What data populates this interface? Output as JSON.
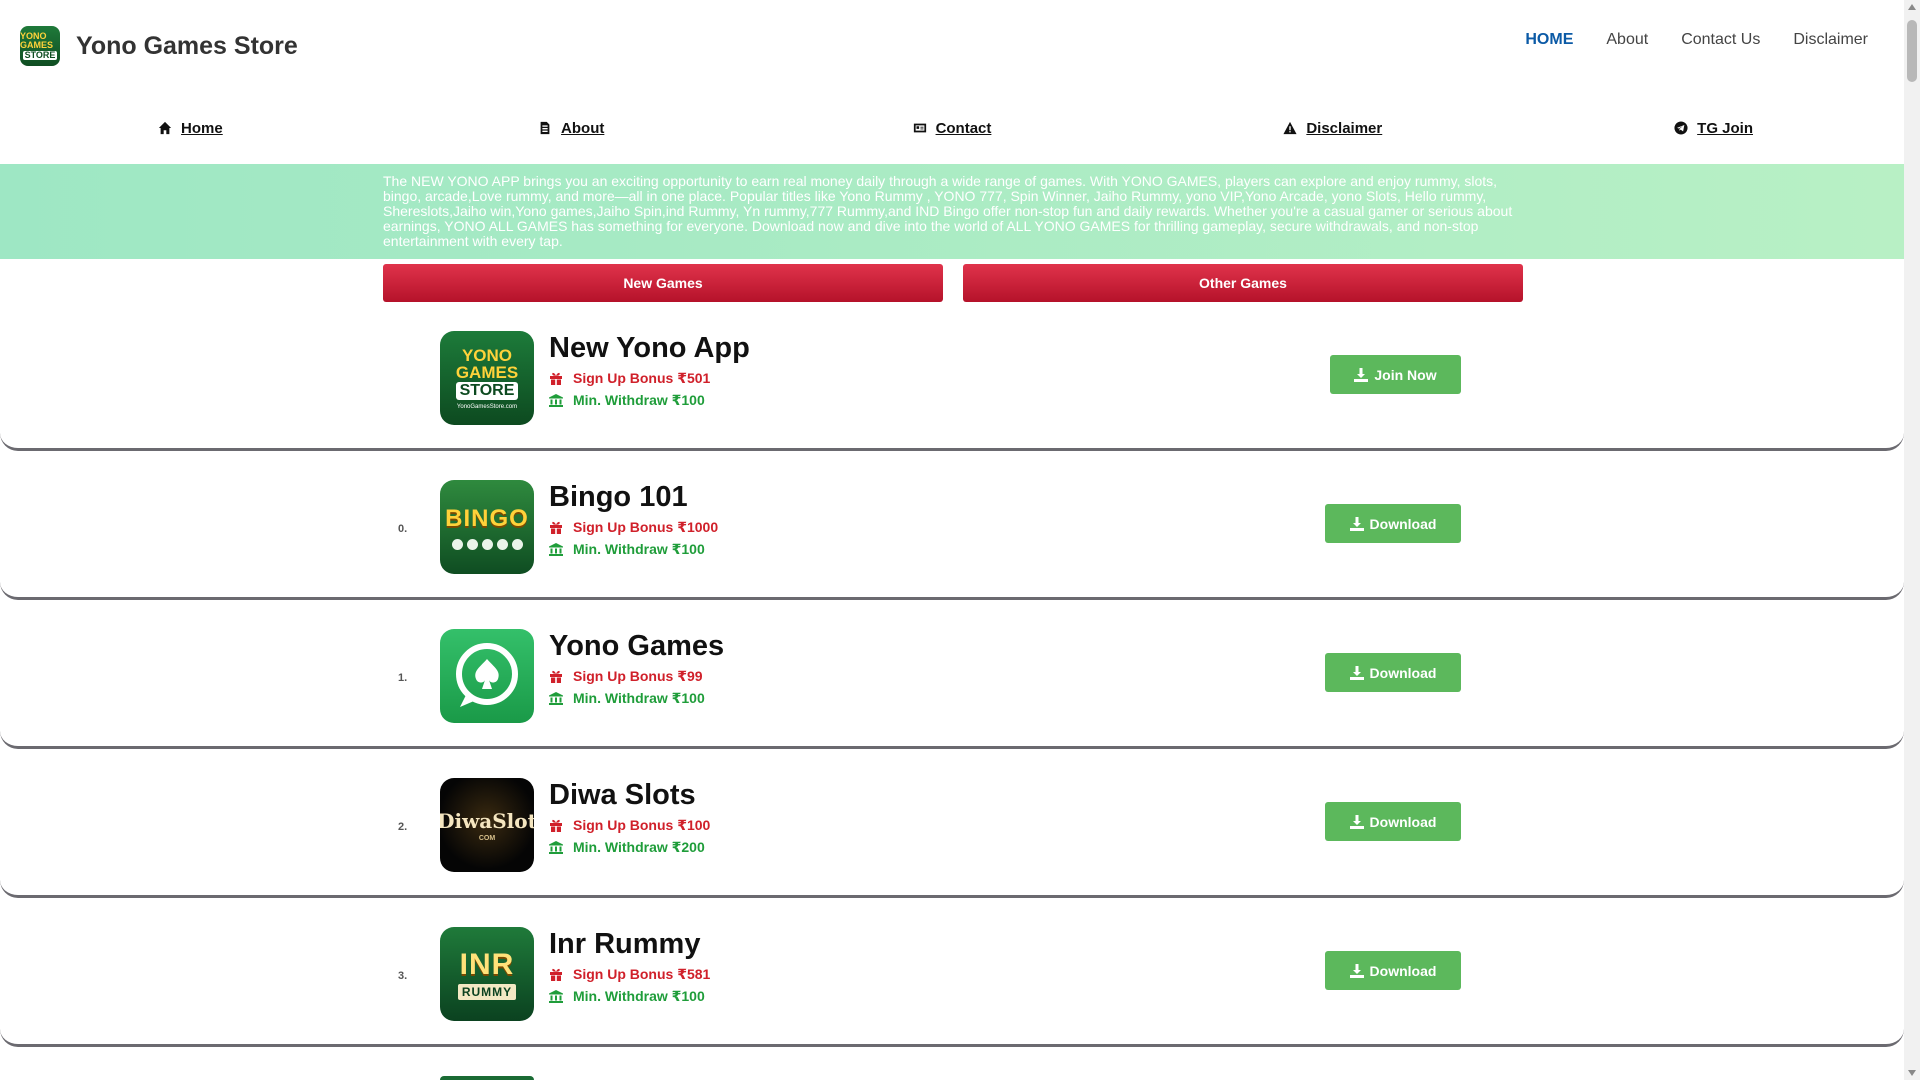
{
  "header": {
    "brand_name": "Yono Games Store",
    "logo_top": "YONO GAMES",
    "logo_bottom": "STORE",
    "nav": [
      "HOME",
      "About",
      "Contact Us",
      "Disclaimer"
    ]
  },
  "subnav": [
    {
      "label": "Home",
      "icon": "home-icon"
    },
    {
      "label": "About",
      "icon": "document-icon"
    },
    {
      "label": "Contact",
      "icon": "contact-card-icon"
    },
    {
      "label": "Disclaimer",
      "icon": "warning-icon"
    },
    {
      "label": "TG Join",
      "icon": "telegram-icon"
    }
  ],
  "banner": {
    "text": "The NEW YONO APP brings you an exciting opportunity to earn real money daily through a wide range of games. With YONO GAMES, players can explore and enjoy rummy, slots, bingo, arcade,Love rummy, and more—all in one place. Popular titles like Yono Rummy , YONO 777, Spin Winner, Jaiho Rummy, yono VIP,Yono Arcade, yono Slots, Hello rummy, Shereslots,Jaiho win,Yono games,Jaiho Spin,ind Rummy, Yn rummy,777 Rummy,and IND Bingo offer non-stop fun and daily rewards. Whether you're a casual gamer or serious about earnings, YONO ALL GAMES has something for everyone. Download now and dive into the world of ALL YONO GAMES for thrilling gameplay, secure withdrawals, and non-stop entertainment with every tap."
  },
  "tabs": [
    "New Games",
    "Other Games"
  ],
  "games": [
    {
      "rank": "",
      "title": "New Yono App",
      "bonus": "Sign Up Bonus ₹501",
      "withdraw": "Min. Withdraw ₹100",
      "button": "Join Now",
      "icon_text": [
        "YONO",
        "GAMES",
        "STORE",
        "YonoGamesStore.com"
      ]
    },
    {
      "rank": "0.",
      "title": "Bingo 101",
      "bonus": "Sign Up Bonus ₹1000",
      "withdraw": "Min. Withdraw ₹100",
      "button": "Download",
      "icon_text": [
        "BINGO"
      ]
    },
    {
      "rank": "1.",
      "title": "Yono Games",
      "bonus": "Sign Up Bonus ₹99",
      "withdraw": "Min. Withdraw ₹100",
      "button": "Download",
      "icon_text": []
    },
    {
      "rank": "2.",
      "title": "Diwa Slots",
      "bonus": "Sign Up Bonus ₹100",
      "withdraw": "Min. Withdraw ₹200",
      "button": "Download",
      "icon_text": [
        "DiwaSlot",
        "COM"
      ]
    },
    {
      "rank": "3.",
      "title": "Inr Rummy",
      "bonus": "Sign Up Bonus ₹581",
      "withdraw": "Min. Withdraw ₹100",
      "button": "Download",
      "icon_text": [
        "INR",
        "RUMMY"
      ]
    }
  ],
  "colors": {
    "accent_red": "#d0202a",
    "accent_green": "#5cb85c",
    "nav_active": "#0b5aa6"
  }
}
